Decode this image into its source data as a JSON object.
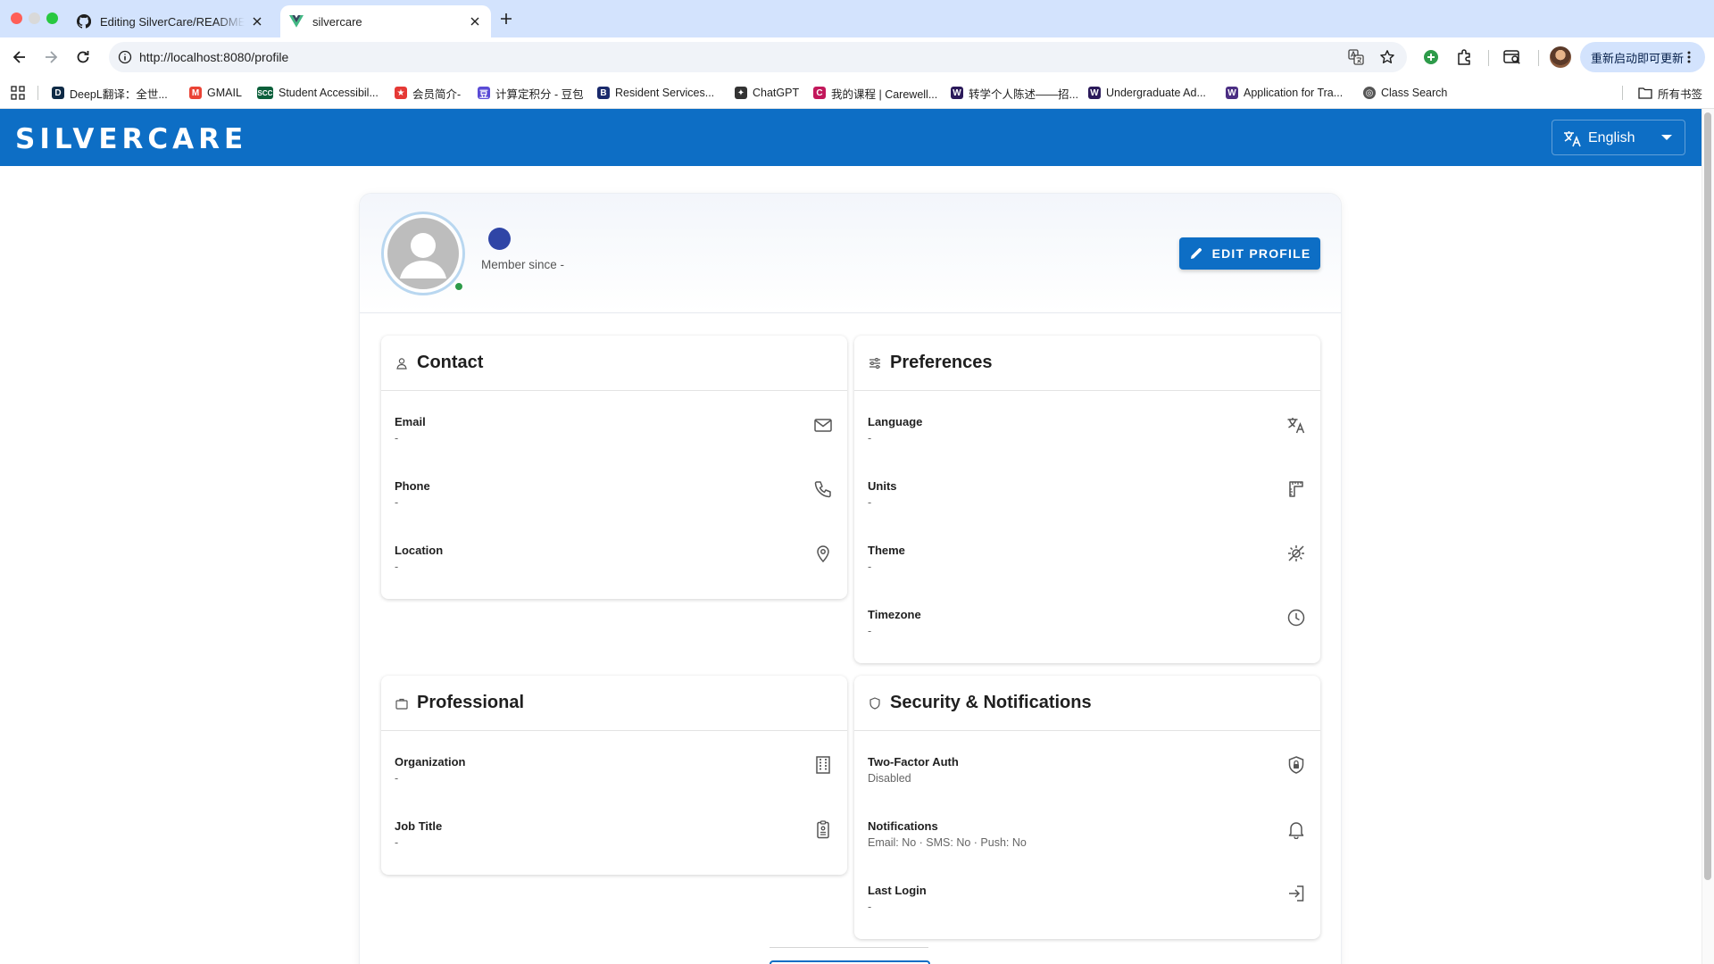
{
  "browser": {
    "tabs": [
      {
        "title": "Editing SilverCare/README.md",
        "active": false,
        "icon": "github-icon"
      },
      {
        "title": "silvercare",
        "active": true,
        "icon": "vue-icon"
      }
    ],
    "url": "http://localhost:8080/profile",
    "update_button": "重新启动即可更新",
    "bookmarks": [
      {
        "label": "DeepL翻译：全世...",
        "icon": "deepl-icon",
        "color": "#0f2b46"
      },
      {
        "label": "GMAIL",
        "icon": "gmail-icon",
        "color": "#ea4335"
      },
      {
        "label": "Student Accessibil...",
        "icon": "scc-icon",
        "color": "#0b5f3a"
      },
      {
        "label": "会员简介-",
        "icon": "star-logo-icon",
        "color": "#e53935"
      },
      {
        "label": "计算定积分 - 豆包",
        "icon": "doubao-icon",
        "color": "#5a4bd6"
      },
      {
        "label": "Resident Services...",
        "icon": "b-icon",
        "color": "#1a2a6c"
      },
      {
        "label": "ChatGPT",
        "icon": "chatgpt-icon",
        "color": "#333333"
      },
      {
        "label": "我的课程 | Carewell...",
        "icon": "carewell-icon",
        "color": "#c2185b"
      },
      {
        "label": "转学个人陈述——招...",
        "icon": "w-icon",
        "color": "#2b1a5a"
      },
      {
        "label": "Undergraduate Ad...",
        "icon": "w-icon",
        "color": "#2b1a5a"
      },
      {
        "label": "Application for Tra...",
        "icon": "w-icon",
        "color": "#4b2e83"
      },
      {
        "label": "Class Search",
        "icon": "globe-icon",
        "color": "#555555"
      }
    ],
    "all_bookmarks": "所有书签"
  },
  "app": {
    "brand": "SILVERCARE",
    "language": "English",
    "accent": "#0d6ec5"
  },
  "profile": {
    "member_since": "Member since -",
    "edit_button": "EDIT PROFILE"
  },
  "cards": {
    "contact": {
      "title": "Contact",
      "rows": [
        {
          "label": "Email",
          "value": "-"
        },
        {
          "label": "Phone",
          "value": "-"
        },
        {
          "label": "Location",
          "value": "-"
        }
      ]
    },
    "preferences": {
      "title": "Preferences",
      "rows": [
        {
          "label": "Language",
          "value": "-"
        },
        {
          "label": "Units",
          "value": "-"
        },
        {
          "label": "Theme",
          "value": "-"
        },
        {
          "label": "Timezone",
          "value": "-"
        }
      ]
    },
    "professional": {
      "title": "Professional",
      "rows": [
        {
          "label": "Organization",
          "value": "-"
        },
        {
          "label": "Job Title",
          "value": "-"
        }
      ]
    },
    "security": {
      "title": "Security & Notifications",
      "rows": [
        {
          "label": "Two-Factor Auth",
          "value": "Disabled"
        },
        {
          "label": "Notifications",
          "value": "Email: No · SMS: No · Push: No"
        },
        {
          "label": "Last Login",
          "value": "-"
        }
      ]
    }
  }
}
